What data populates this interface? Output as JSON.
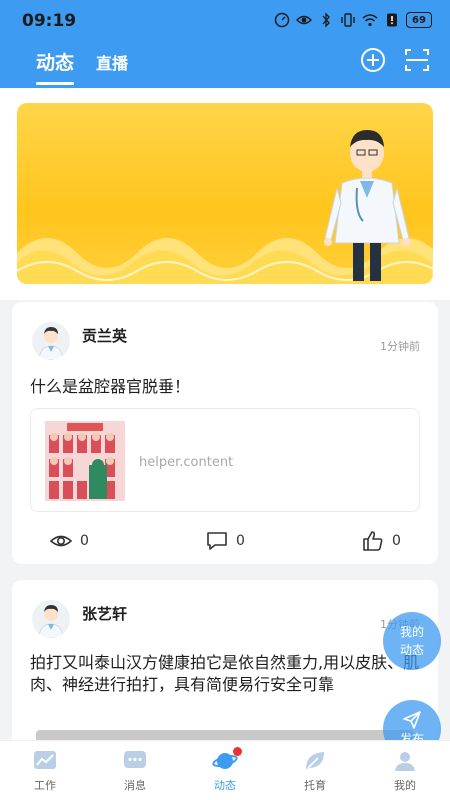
{
  "status_bar": {
    "time": "09:19",
    "battery": "69"
  },
  "header": {
    "tabs": [
      {
        "label": "动态",
        "active": true
      },
      {
        "label": "直播",
        "active": false
      }
    ]
  },
  "posts": [
    {
      "user": "贡兰英",
      "time": "1分钟前",
      "text": "什么是盆腔器官脱垂！",
      "link_text": "helper.content",
      "views": "0",
      "comments": "0",
      "likes": "0"
    },
    {
      "user": "张艺轩",
      "time": "1分钟前",
      "text": "拍打又叫泰山汉方健康拍它是依自然重力,用以皮肤、肌肉、神经进行拍打，具有简便易行安全可靠"
    }
  ],
  "floating": {
    "my_moments": [
      "我的",
      "动态"
    ],
    "post": "发布"
  },
  "bottom_nav": [
    {
      "label": "工作",
      "icon": "chart-icon",
      "active": false
    },
    {
      "label": "消息",
      "icon": "message-icon",
      "active": false
    },
    {
      "label": "动态",
      "icon": "planet-icon",
      "active": true
    },
    {
      "label": "托育",
      "icon": "leaf-icon",
      "active": false
    },
    {
      "label": "我的",
      "icon": "user-icon",
      "active": false
    }
  ],
  "colors": {
    "primary": "#3d9bf2",
    "banner": "#ffc51c",
    "badge": "#f03030"
  }
}
